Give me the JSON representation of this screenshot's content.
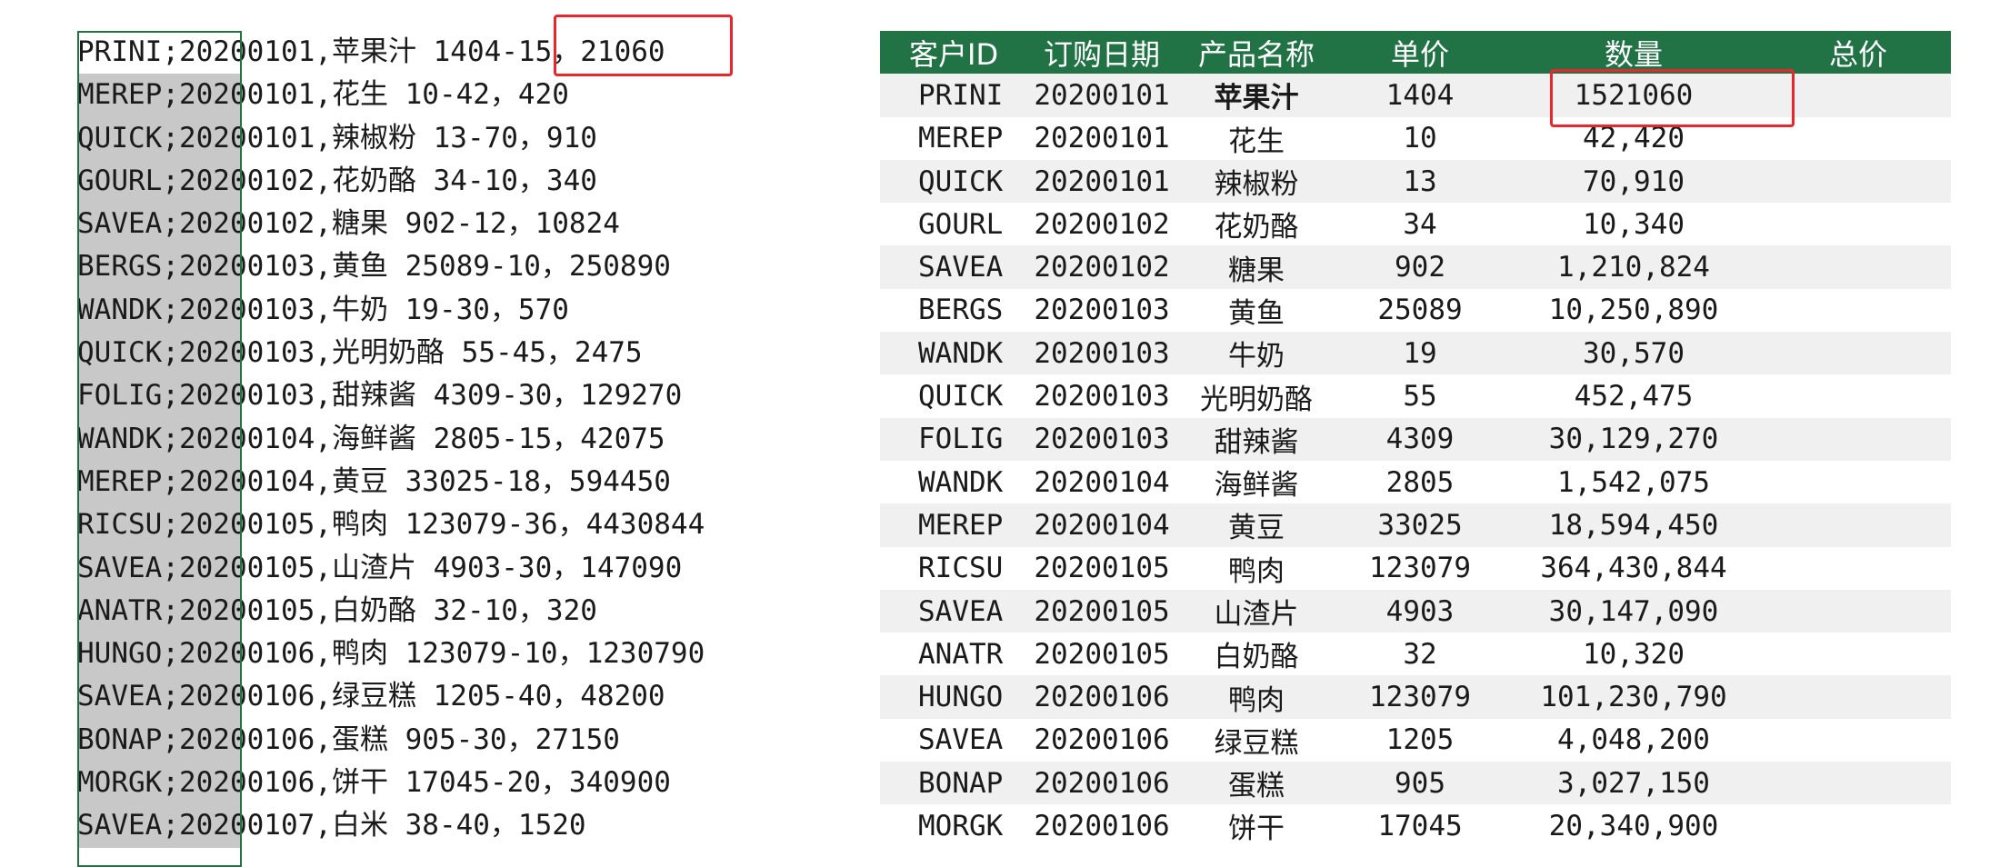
{
  "raw_lines": [
    "PRINI;20200101,苹果汁 1404-15，21060",
    "MEREP;20200101,花生 10-42，420",
    "QUICK;20200101,辣椒粉 13-70，910",
    "GOURL;20200102,花奶酪 34-10，340",
    "SAVEA;20200102,糖果 902-12，10824",
    "BERGS;20200103,黄鱼 25089-10，250890",
    "WANDK;20200103,牛奶 19-30，570",
    "QUICK;20200103,光明奶酪 55-45，2475",
    "FOLIG;20200103,甜辣酱 4309-30，129270",
    "WANDK;20200104,海鲜酱 2805-15，42075",
    "MEREP;20200104,黄豆 33025-18，594450",
    "RICSU;20200105,鸭肉 123079-36，4430844",
    "SAVEA;20200105,山渣片 4903-30，147090",
    "ANATR;20200105,白奶酪 32-10，320",
    "HUNGO;20200106,鸭肉 123079-10，1230790",
    "SAVEA;20200106,绿豆糕 1205-40，48200",
    "BONAP;20200106,蛋糕 905-30，27150",
    "MORGK;20200106,饼干 17045-20，340900",
    "SAVEA;20200107,白米 38-40，1520"
  ],
  "table": {
    "headers": [
      "客户ID",
      "订购日期",
      "产品名称",
      "单价",
      "数量",
      "总价"
    ],
    "rows": [
      [
        "PRINI",
        "20200101",
        "苹果汁",
        "1404",
        "1521060",
        ""
      ],
      [
        "MEREP",
        "20200101",
        "花生",
        "10",
        "42,420",
        ""
      ],
      [
        "QUICK",
        "20200101",
        "辣椒粉",
        "13",
        "70,910",
        ""
      ],
      [
        "GOURL",
        "20200102",
        "花奶酪",
        "34",
        "10,340",
        ""
      ],
      [
        "SAVEA",
        "20200102",
        "糖果",
        "902",
        "1,210,824",
        ""
      ],
      [
        "BERGS",
        "20200103",
        "黄鱼",
        "25089",
        "10,250,890",
        ""
      ],
      [
        "WANDK",
        "20200103",
        "牛奶",
        "19",
        "30,570",
        ""
      ],
      [
        "QUICK",
        "20200103",
        "光明奶酪",
        "55",
        "452,475",
        ""
      ],
      [
        "FOLIG",
        "20200103",
        "甜辣酱",
        "4309",
        "30,129,270",
        ""
      ],
      [
        "WANDK",
        "20200104",
        "海鲜酱",
        "2805",
        "1,542,075",
        ""
      ],
      [
        "MEREP",
        "20200104",
        "黄豆",
        "33025",
        "18,594,450",
        ""
      ],
      [
        "RICSU",
        "20200105",
        "鸭肉",
        "123079",
        "364,430,844",
        ""
      ],
      [
        "SAVEA",
        "20200105",
        "山渣片",
        "4903",
        "30,147,090",
        ""
      ],
      [
        "ANATR",
        "20200105",
        "白奶酪",
        "32",
        "10,320",
        ""
      ],
      [
        "HUNGO",
        "20200106",
        "鸭肉",
        "123079",
        "101,230,790",
        ""
      ],
      [
        "SAVEA",
        "20200106",
        "绿豆糕",
        "1205",
        "4,048,200",
        ""
      ],
      [
        "BONAP",
        "20200106",
        "蛋糕",
        "905",
        "3,027,150",
        ""
      ],
      [
        "MORGK",
        "20200106",
        "饼干",
        "17045",
        "20,340,900",
        ""
      ]
    ]
  },
  "colors": {
    "header_bg": "#217346",
    "selection_border": "#217346",
    "selection_fill": "#c8c8c8",
    "callout": "#e8262b",
    "row_shade": "#f0f0f0"
  }
}
